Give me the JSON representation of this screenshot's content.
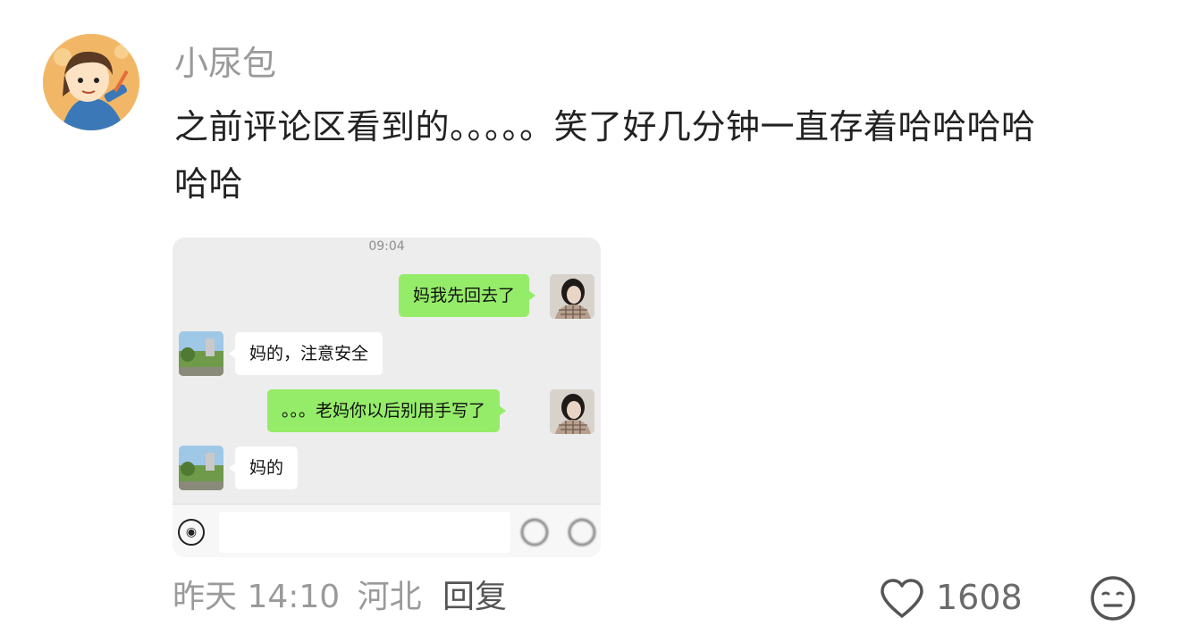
{
  "comment": {
    "username": "小尿包",
    "text_line1": "之前评论区看到的。。。。。笑了好几分钟一直存着哈哈哈哈",
    "text_line2": "哈哈",
    "time": "昨天 14:10",
    "location": "河北",
    "reply_label": "回复",
    "likes": "1608"
  },
  "chat_screenshot": {
    "time": "09:04",
    "messages": [
      {
        "side": "out",
        "text": "妈我先回去了"
      },
      {
        "side": "in",
        "text": "妈的，注意安全"
      },
      {
        "side": "out",
        "text": "。。。老妈你以后别用手写了"
      },
      {
        "side": "in",
        "text": "妈的"
      }
    ]
  },
  "icons": {
    "like": "heart-outline-icon",
    "emoji": "neutral-face-icon",
    "voice": "voice-icon"
  },
  "colors": {
    "out_bubble": "#95ec69",
    "chat_bg": "#ededed",
    "meta_text": "#9a9a9a"
  }
}
